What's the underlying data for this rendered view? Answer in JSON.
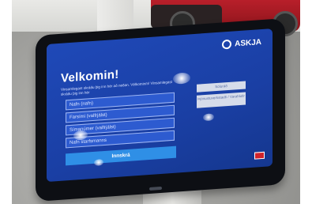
{
  "screen": {
    "brand": "ASKJA",
    "heading": "Velkomin!",
    "intro": "Vinsamlegast skráðu þig inn hér að neðan. Vélkomin/n! Vinsamlegast skráðu þig inn hér",
    "fields": [
      {
        "placeholder": "Nafn (nafn)"
      },
      {
        "placeholder": "Farsími (valfrjálst)"
      },
      {
        "placeholder": "Símanúmer (valfrjálst)"
      },
      {
        "placeholder": "Nafn starfsmanns"
      }
    ],
    "submit_label": "Innskrá",
    "side_buttons": [
      {
        "label": "Söluráð"
      },
      {
        "label": "Þjónustuverkstæði / Varahlutir"
      }
    ],
    "language_flag": "uk-flag-icon"
  }
}
